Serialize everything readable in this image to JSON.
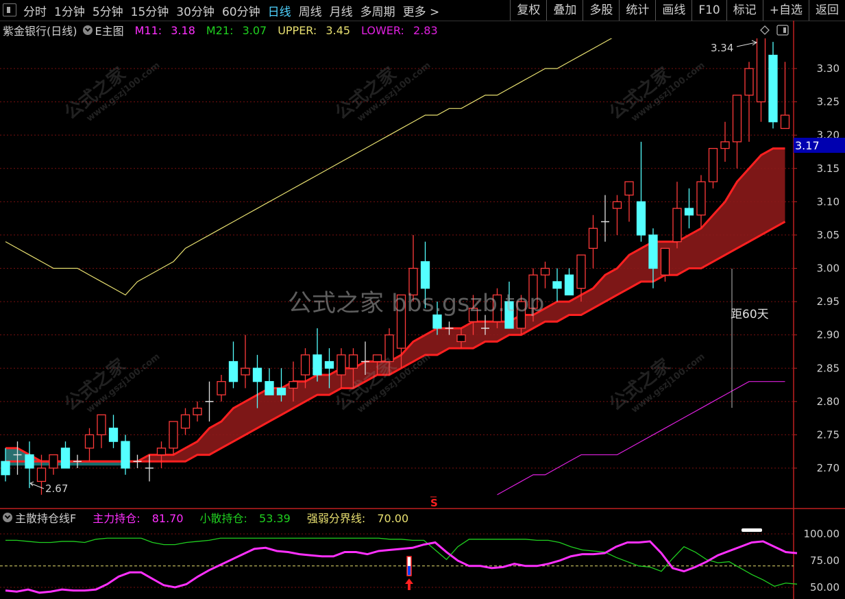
{
  "toolbar": {
    "periods": [
      "分时",
      "1分钟",
      "5分钟",
      "15分钟",
      "30分钟",
      "60分钟",
      "日线",
      "周线",
      "月线",
      "多周期",
      "更多 >"
    ],
    "active_period": "日线",
    "right_buttons": [
      "复权",
      "叠加",
      "多股",
      "统计",
      "画线",
      "F10",
      "标记",
      "+自选",
      "返回"
    ]
  },
  "main_legend": {
    "stock": "紫金银行(日线)",
    "indicator": "E主图",
    "m11_label": "M11:",
    "m11_value": "3.18",
    "m21_label": "M21:",
    "m21_value": "3.07",
    "upper_label": "UPPER:",
    "upper_value": "3.45",
    "lower_label": "LOWER:",
    "lower_value": "2.83"
  },
  "sub_legend": {
    "indicator": "主散持仓线F",
    "main_label": "主力持仓:",
    "main_value": "81.70",
    "retail_label": "小散持仓:",
    "retail_value": "53.39",
    "threshold_label": "强弱分界线:",
    "threshold_value": "70.00"
  },
  "annotations": {
    "high_label": "3.34",
    "low_label": "2.67",
    "days_label": "距60天",
    "signal_marker": "S",
    "current_price": "3.17"
  },
  "watermarks": {
    "big": "公式之家",
    "small": "www.gszj100.com",
    "center": "公式之家 bbs.gszb.top"
  },
  "colors": {
    "up": "#ff3a3a",
    "down": "#54ffff",
    "m_line": "#ff2020",
    "ribbon": "#8b1a1a",
    "upper": "#e8e070",
    "lower": "#e020e0",
    "main_pos": "#ff30ff",
    "retail_pos": "#20d020",
    "threshold": "#e8e070",
    "price_tag": "#0000b0"
  },
  "chart_data": [
    {
      "type": "candlestick",
      "price_axis": [
        3.3,
        3.25,
        3.2,
        3.15,
        3.1,
        3.05,
        3.0,
        2.95,
        2.9,
        2.85,
        2.8,
        2.75,
        2.7
      ],
      "ylim": [
        2.64,
        3.4
      ],
      "candles": [
        [
          2.71,
          2.73,
          2.68,
          2.69
        ],
        [
          2.72,
          2.74,
          2.69,
          2.72
        ],
        [
          2.72,
          2.74,
          2.67,
          2.7
        ],
        [
          2.68,
          2.72,
          2.66,
          2.7
        ],
        [
          2.7,
          2.72,
          2.69,
          2.72
        ],
        [
          2.73,
          2.74,
          2.7,
          2.7
        ],
        [
          2.71,
          2.72,
          2.7,
          2.71
        ],
        [
          2.73,
          2.76,
          2.71,
          2.75
        ],
        [
          2.75,
          2.78,
          2.73,
          2.78
        ],
        [
          2.76,
          2.78,
          2.73,
          2.74
        ],
        [
          2.74,
          2.75,
          2.69,
          2.7
        ],
        [
          2.71,
          2.72,
          2.7,
          2.71
        ],
        [
          2.7,
          2.72,
          2.68,
          2.7
        ],
        [
          2.72,
          2.74,
          2.7,
          2.73
        ],
        [
          2.73,
          2.77,
          2.72,
          2.77
        ],
        [
          2.76,
          2.79,
          2.75,
          2.78
        ],
        [
          2.78,
          2.8,
          2.77,
          2.79
        ],
        [
          2.8,
          2.83,
          2.77,
          2.8
        ],
        [
          2.81,
          2.84,
          2.8,
          2.83
        ],
        [
          2.86,
          2.89,
          2.82,
          2.83
        ],
        [
          2.84,
          2.9,
          2.82,
          2.85
        ],
        [
          2.85,
          2.87,
          2.79,
          2.83
        ],
        [
          2.83,
          2.85,
          2.81,
          2.81
        ],
        [
          2.82,
          2.85,
          2.8,
          2.81
        ],
        [
          2.82,
          2.86,
          2.8,
          2.83
        ],
        [
          2.84,
          2.88,
          2.82,
          2.87
        ],
        [
          2.87,
          2.91,
          2.83,
          2.84
        ],
        [
          2.86,
          2.88,
          2.82,
          2.85
        ],
        [
          2.84,
          2.88,
          2.82,
          2.87
        ],
        [
          2.85,
          2.88,
          2.82,
          2.87
        ],
        [
          2.86,
          2.89,
          2.84,
          2.86
        ],
        [
          2.86,
          2.87,
          2.84,
          2.87
        ],
        [
          2.86,
          2.91,
          2.84,
          2.9
        ],
        [
          2.88,
          2.96,
          2.85,
          2.96
        ],
        [
          2.96,
          3.05,
          2.95,
          3.0
        ],
        [
          3.01,
          3.04,
          2.94,
          2.97
        ],
        [
          2.93,
          2.95,
          2.9,
          2.91
        ],
        [
          2.91,
          2.92,
          2.9,
          2.91
        ],
        [
          2.89,
          2.91,
          2.88,
          2.9
        ],
        [
          2.92,
          2.96,
          2.9,
          2.94
        ],
        [
          2.91,
          2.93,
          2.9,
          2.91
        ],
        [
          2.92,
          2.97,
          2.91,
          2.96
        ],
        [
          2.95,
          2.98,
          2.91,
          2.91
        ],
        [
          2.91,
          2.96,
          2.9,
          2.95
        ],
        [
          2.94,
          3.0,
          2.92,
          2.99
        ],
        [
          2.99,
          3.01,
          2.97,
          3.0
        ],
        [
          2.98,
          3.0,
          2.95,
          2.97
        ],
        [
          2.99,
          3.0,
          2.96,
          2.96
        ],
        [
          2.97,
          3.02,
          2.95,
          3.02
        ],
        [
          3.03,
          3.08,
          3.0,
          3.06
        ],
        [
          3.07,
          3.11,
          3.04,
          3.07
        ],
        [
          3.09,
          3.11,
          3.05,
          3.1
        ],
        [
          3.11,
          3.12,
          3.07,
          3.13
        ],
        [
          3.1,
          3.19,
          3.04,
          3.05
        ],
        [
          3.05,
          3.06,
          2.97,
          3.0
        ],
        [
          2.99,
          3.03,
          2.98,
          3.03
        ],
        [
          3.04,
          3.13,
          3.03,
          3.09
        ],
        [
          3.09,
          3.12,
          3.06,
          3.08
        ],
        [
          3.08,
          3.14,
          3.06,
          3.13
        ],
        [
          3.13,
          3.18,
          3.12,
          3.18
        ],
        [
          3.18,
          3.22,
          3.16,
          3.19
        ],
        [
          3.19,
          3.22,
          3.15,
          3.26
        ],
        [
          3.26,
          3.31,
          3.19,
          3.3
        ],
        [
          3.25,
          3.32,
          3.22,
          3.35
        ],
        [
          3.32,
          3.34,
          3.21,
          3.22
        ],
        [
          3.21,
          3.31,
          3.21,
          3.23
        ]
      ],
      "m11": [
        2.73,
        2.73,
        2.72,
        2.71,
        2.71,
        2.71,
        2.71,
        2.71,
        2.71,
        2.71,
        2.71,
        2.71,
        2.72,
        2.72,
        2.72,
        2.73,
        2.74,
        2.76,
        2.77,
        2.79,
        2.8,
        2.81,
        2.82,
        2.82,
        2.83,
        2.83,
        2.84,
        2.84,
        2.85,
        2.85,
        2.86,
        2.86,
        2.86,
        2.87,
        2.89,
        2.9,
        2.91,
        2.91,
        2.91,
        2.92,
        2.92,
        2.92,
        2.92,
        2.93,
        2.93,
        2.94,
        2.95,
        2.95,
        2.96,
        2.97,
        2.99,
        3.0,
        3.02,
        3.03,
        3.04,
        3.04,
        3.04,
        3.05,
        3.06,
        3.08,
        3.1,
        3.13,
        3.15,
        3.17,
        3.18,
        3.18
      ],
      "m21": [
        2.71,
        2.71,
        2.71,
        2.71,
        2.71,
        2.71,
        2.71,
        2.71,
        2.71,
        2.71,
        2.71,
        2.71,
        2.71,
        2.71,
        2.71,
        2.71,
        2.72,
        2.72,
        2.73,
        2.74,
        2.75,
        2.76,
        2.77,
        2.78,
        2.79,
        2.8,
        2.81,
        2.81,
        2.82,
        2.82,
        2.83,
        2.84,
        2.84,
        2.85,
        2.86,
        2.87,
        2.87,
        2.88,
        2.88,
        2.88,
        2.89,
        2.89,
        2.9,
        2.9,
        2.91,
        2.92,
        2.92,
        2.93,
        2.93,
        2.94,
        2.95,
        2.96,
        2.97,
        2.98,
        2.98,
        2.99,
        2.99,
        3.0,
        3.0,
        3.01,
        3.02,
        3.03,
        3.04,
        3.05,
        3.06,
        3.07
      ],
      "upper": [
        3.04,
        3.03,
        3.02,
        3.01,
        3.0,
        3.0,
        3.0,
        2.99,
        2.98,
        2.97,
        2.96,
        2.98,
        2.99,
        3.0,
        3.01,
        3.03,
        3.04,
        3.05,
        3.06,
        3.07,
        3.08,
        3.09,
        3.1,
        3.11,
        3.12,
        3.13,
        3.14,
        3.15,
        3.16,
        3.17,
        3.18,
        3.19,
        3.2,
        3.21,
        3.22,
        3.23,
        3.23,
        3.24,
        3.24,
        3.25,
        3.26,
        3.26,
        3.27,
        3.28,
        3.29,
        3.3,
        3.3,
        3.31,
        3.32,
        3.33,
        3.34,
        3.35,
        3.36,
        3.37,
        3.37,
        3.37,
        3.38,
        3.38,
        3.39,
        3.39,
        3.4,
        3.41,
        3.42,
        3.43,
        3.44,
        3.45
      ],
      "lower_start_index": 41,
      "lower": [
        2.66,
        2.67,
        2.68,
        2.69,
        2.69,
        2.7,
        2.71,
        2.72,
        2.72,
        2.72,
        2.72,
        2.73,
        2.74,
        2.75,
        2.76,
        2.77,
        2.78,
        2.79,
        2.8,
        2.81,
        2.82,
        2.83,
        2.83,
        2.83,
        2.83
      ]
    },
    {
      "type": "line",
      "price_axis": [
        100.0,
        75.0,
        50.0
      ],
      "ylim": [
        45,
        108
      ],
      "series": [
        {
          "name": "主力持仓",
          "values": [
            47,
            46,
            48,
            45,
            46,
            48,
            47,
            47,
            48,
            53,
            60,
            64,
            64,
            58,
            52,
            50,
            53,
            60,
            66,
            71,
            76,
            81,
            86,
            87,
            84,
            83,
            81,
            80,
            79,
            79,
            83,
            83,
            81,
            84,
            85,
            86,
            87,
            90,
            92,
            83,
            75,
            70,
            70,
            68,
            69,
            72,
            70,
            70,
            72,
            75,
            79,
            81,
            81,
            82,
            88,
            92,
            92,
            93,
            82,
            68,
            65,
            69,
            74,
            80,
            84,
            88,
            92,
            93,
            88,
            83,
            82
          ]
        },
        {
          "name": "小散持仓",
          "values": [
            94,
            94,
            93,
            92,
            92,
            93,
            93,
            92,
            95,
            96,
            96,
            96,
            96,
            92,
            90,
            90,
            92,
            93,
            94,
            96,
            96,
            96,
            96,
            96,
            96,
            96,
            96,
            96,
            96,
            96,
            96,
            96,
            96,
            96,
            95,
            95,
            94,
            94,
            85,
            76,
            88,
            95,
            95,
            95,
            95,
            95,
            95,
            94,
            94,
            92,
            88,
            85,
            84,
            83,
            78,
            74,
            70,
            69,
            65,
            77,
            88,
            83,
            76,
            73,
            74,
            68,
            62,
            57,
            51,
            54,
            53
          ]
        },
        {
          "name": "强弱分界线",
          "values": [
            70
          ]
        }
      ]
    }
  ]
}
